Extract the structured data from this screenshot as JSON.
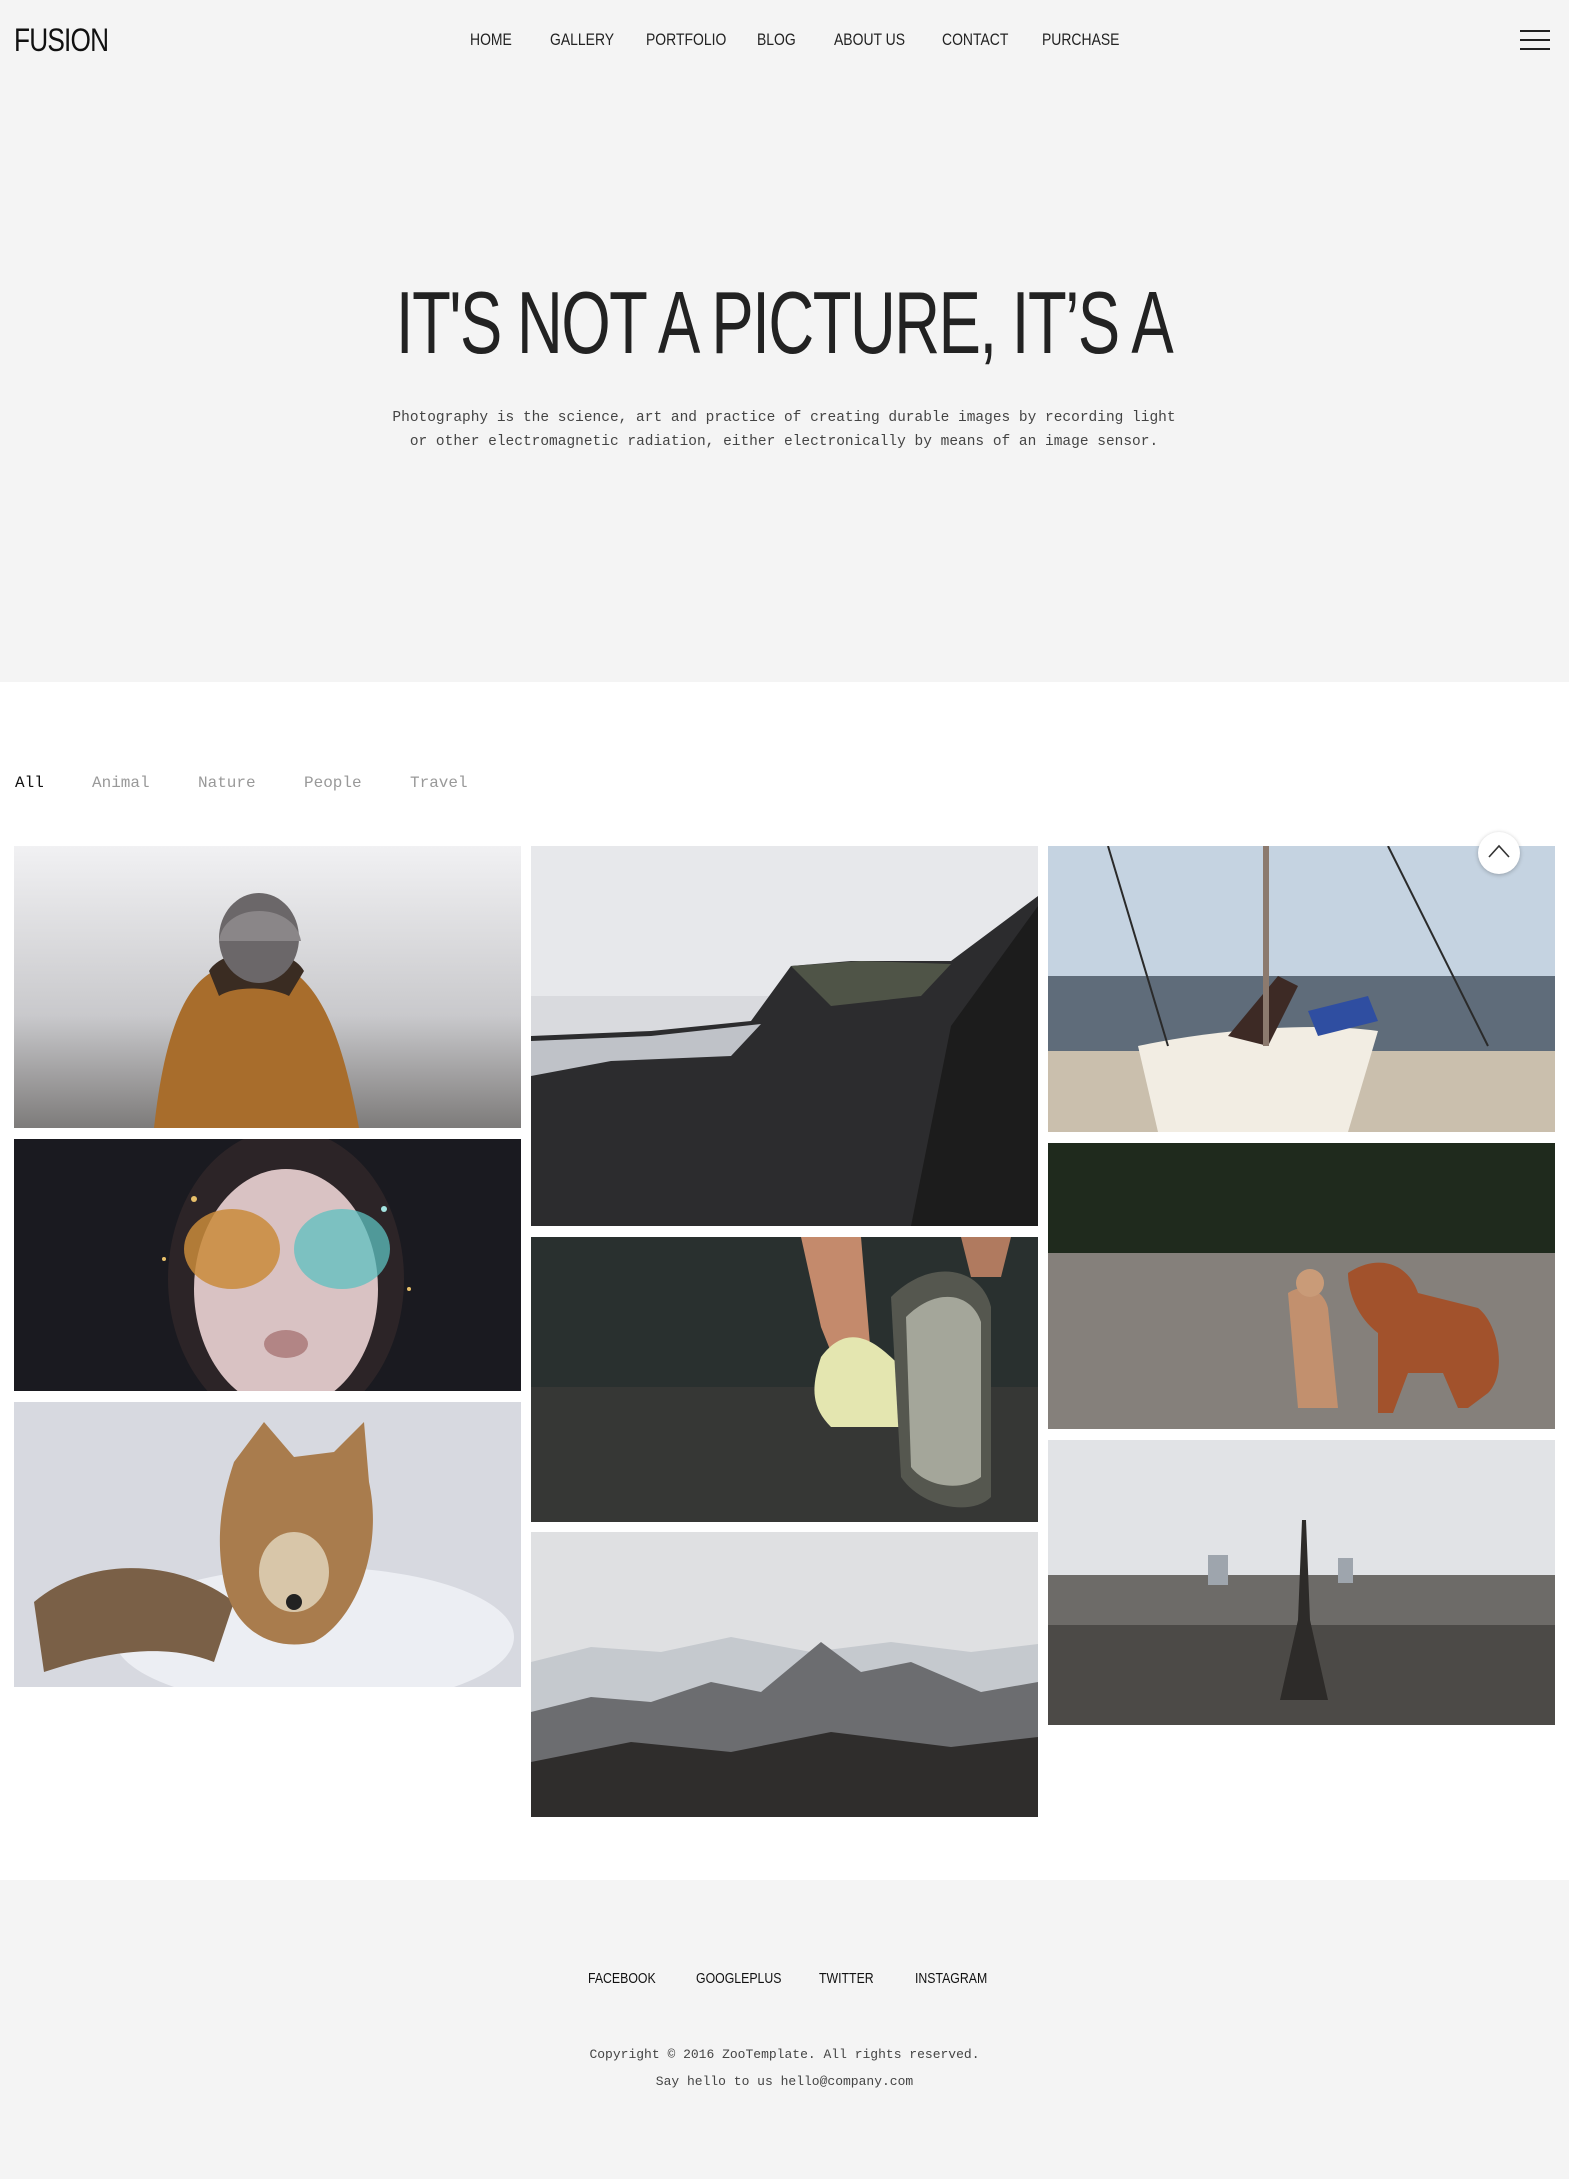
{
  "header": {
    "logo": "FUSION",
    "nav": [
      "HOME",
      "GALLERY",
      "PORTFOLIO",
      "BLOG",
      "ABOUT US",
      "CONTACT",
      "PURCHASE"
    ]
  },
  "hero": {
    "title": "IT'S NOT A PICTURE, IT’S A",
    "description": "Photography is the science, art and practice of creating durable images by recording light or other electromagnetic radiation, either electronically by means of an image sensor."
  },
  "filters": {
    "items": [
      "All",
      "Animal",
      "Nature",
      "People",
      "Travel"
    ],
    "active": "All"
  },
  "gallery": [
    {
      "subject": "person in beanie and hooded jacket"
    },
    {
      "subject": "face with glitter makeup"
    },
    {
      "subject": "fox jumping in snow"
    },
    {
      "subject": "mountain cliff"
    },
    {
      "subject": "running shoes"
    },
    {
      "subject": "mountain range"
    },
    {
      "subject": "boat on beach"
    },
    {
      "subject": "two dogs"
    },
    {
      "subject": "paris eiffel tower skyline"
    }
  ],
  "footer": {
    "social": [
      "FACEBOOK",
      "GOOGLEPLUS",
      "TWITTER",
      "INSTAGRAM"
    ],
    "copyright": "Copyright © 2016 ZooTemplate. All rights reserved.",
    "contact": "Say hello to us hello@company.com"
  },
  "colors": {
    "hero_bg": "#f4f4f4",
    "text": "#222222",
    "muted": "#999999"
  }
}
